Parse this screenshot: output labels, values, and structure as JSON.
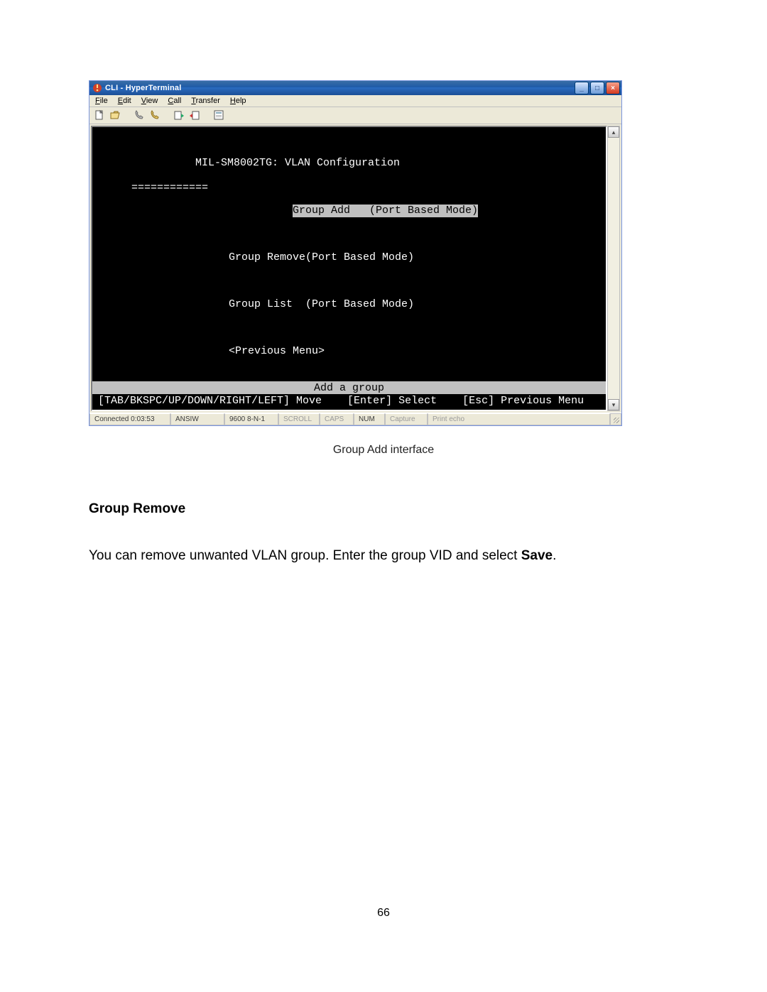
{
  "window": {
    "title": "CLI - HyperTerminal",
    "icon_name": "hyperterminal-app-icon",
    "caption_buttons": {
      "minimize": "_",
      "maximize": "□",
      "close": "×"
    }
  },
  "menubar": {
    "items": [
      {
        "label": "File",
        "u": "F"
      },
      {
        "label": "Edit",
        "u": "E"
      },
      {
        "label": "View",
        "u": "V"
      },
      {
        "label": "Call",
        "u": "C"
      },
      {
        "label": "Transfer",
        "u": "T"
      },
      {
        "label": "Help",
        "u": "H"
      }
    ]
  },
  "toolbar": {
    "icons": [
      "new-file-icon",
      "open-file-icon",
      "call-icon",
      "disconnect-icon",
      "send-icon",
      "receive-icon",
      "properties-icon"
    ]
  },
  "terminal": {
    "title_line": "MIL-SM8002TG: VLAN Configuration",
    "title_underline": "============",
    "menu": [
      {
        "label": "Group Add   (Port Based Mode)",
        "selected": true
      },
      {
        "label": "Group Remove(Port Based Mode)",
        "selected": false
      },
      {
        "label": "Group List  (Port Based Mode)",
        "selected": false
      },
      {
        "label": "<Previous Menu>",
        "selected": false
      }
    ],
    "hint_bar": "Add a group",
    "nav_hint": "[TAB/BKSPC/UP/DOWN/RIGHT/LEFT] Move    [Enter] Select    [Esc] Previous Menu"
  },
  "statusbar": {
    "cells": [
      {
        "text": "Connected 0:03:53",
        "dim": false
      },
      {
        "text": "ANSIW",
        "dim": false
      },
      {
        "text": "9600 8-N-1",
        "dim": false
      },
      {
        "text": "SCROLL",
        "dim": true
      },
      {
        "text": "CAPS",
        "dim": true
      },
      {
        "text": "NUM",
        "dim": false
      },
      {
        "text": "Capture",
        "dim": true
      },
      {
        "text": "Print echo",
        "dim": true
      }
    ]
  },
  "figure_caption": "Group Add interface",
  "section_heading": "Group Remove",
  "paragraph": {
    "pre": "You can remove unwanted VLAN group. Enter the group VID and select ",
    "bold": "Save",
    "post": "."
  },
  "page_number": "66"
}
